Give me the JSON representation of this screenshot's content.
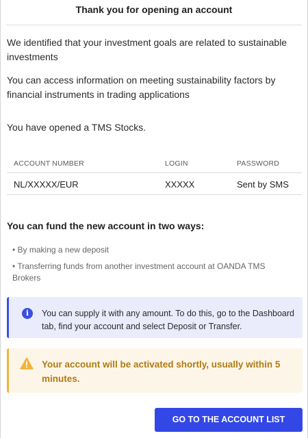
{
  "dialog": {
    "title": "Thank you for opening an account"
  },
  "intro": {
    "goals_text": "We identified that your investment goals are related to sustainable investments",
    "sustainability_text": "You can access information on meeting sustainability factors by financial instruments in trading applications",
    "opened_text": "You have opened a TMS Stocks."
  },
  "account_table": {
    "headers": {
      "account_number": "ACCOUNT NUMBER",
      "login": "LOGIN",
      "password": "PASSWORD"
    },
    "row": {
      "account_number": "NL/XXXXX/EUR",
      "login": "XXXXX",
      "password": "Sent by SMS"
    }
  },
  "funding": {
    "title": "You can fund the new account in two ways:",
    "options": [
      "• By making a new deposit",
      "• Transferring funds from another investment account at OANDA TMS Brokers"
    ]
  },
  "info_notice": {
    "icon": "info-icon",
    "text": "You can supply it with any amount. To do this, go to the Dashboard tab, find your account and select Deposit or Transfer.",
    "color": "#3b50e0"
  },
  "warning_notice": {
    "icon": "warning-icon",
    "text": "Your account will be activated shortly, usually within 5 minutes.",
    "color": "#f0b43c"
  },
  "actions": {
    "primary_label": "GO TO THE ACCOUNT LIST",
    "primary_color": "#3347e6"
  }
}
